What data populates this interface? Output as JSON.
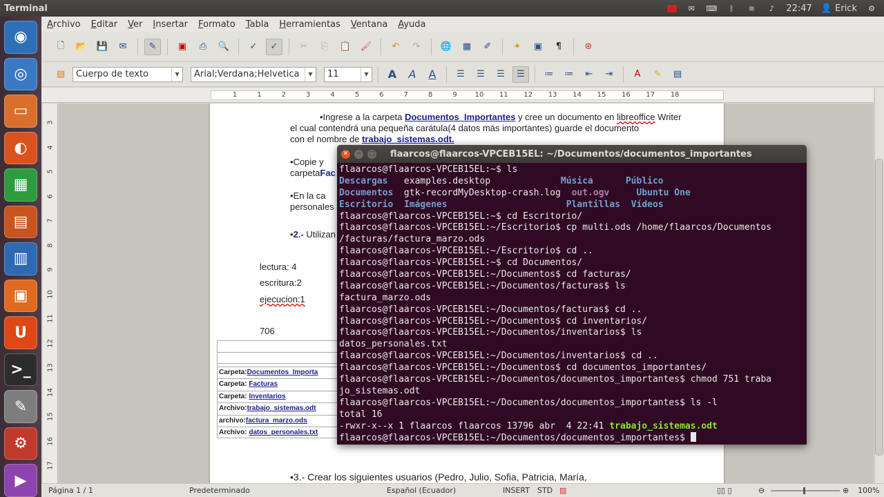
{
  "topbar": {
    "title": "Terminal",
    "time": "22:47",
    "user": "Erick"
  },
  "launcher": [
    {
      "name": "ubuntu-dash-icon",
      "glyph": "◉",
      "color": "#2e6fb7"
    },
    {
      "name": "chromium-icon",
      "glyph": "◎",
      "color": "#3b78c4"
    },
    {
      "name": "files-icon",
      "glyph": "▭",
      "color": "#d86f2a"
    },
    {
      "name": "firefox-icon",
      "glyph": "◐",
      "color": "#d9531e"
    },
    {
      "name": "calc-icon",
      "glyph": "▦",
      "color": "#2e9b3f"
    },
    {
      "name": "impress-icon",
      "glyph": "▤",
      "color": "#c8551f"
    },
    {
      "name": "writer-icon",
      "glyph": "▥",
      "color": "#2f68b3"
    },
    {
      "name": "software-center-icon",
      "glyph": "▣",
      "color": "#e06a1f"
    },
    {
      "name": "ubuntu-one-icon",
      "glyph": "U",
      "color": "#dd4814"
    },
    {
      "name": "terminal-icon",
      "glyph": ">_",
      "color": "#2c2c2c"
    },
    {
      "name": "text-editor-icon",
      "glyph": "✎",
      "color": "#7d7d7d"
    },
    {
      "name": "system-settings-icon",
      "glyph": "⚙",
      "color": "#c0392b"
    },
    {
      "name": "video-editor-icon",
      "glyph": "▶",
      "color": "#8e44ad"
    }
  ],
  "menu": [
    "Archivo",
    "Editar",
    "Ver",
    "Insertar",
    "Formato",
    "Tabla",
    "Herramientas",
    "Ventana",
    "Ayuda"
  ],
  "toolbar2": {
    "style": "Cuerpo de texto",
    "font": "Arial;Verdana;Helvetica",
    "size": "11"
  },
  "ruler_ticks": [
    "1",
    "1",
    "2",
    "3",
    "4",
    "5",
    "6",
    "7",
    "8",
    "9",
    "10",
    "11",
    "12",
    "13",
    "14",
    "15",
    "16",
    "17",
    "18"
  ],
  "vruler_ticks": [
    "3",
    "4",
    "5",
    "6",
    "7",
    "8",
    "9",
    "10",
    "11",
    "12",
    "13",
    "14",
    "15",
    "16",
    "17"
  ],
  "doc": {
    "p1": {
      "a": "•Ingrese a la carpeta ",
      "b": "Documentos_Importantes",
      "c": " y cree un documento en ",
      "d": "libreoffice",
      "e": " Writer"
    },
    "p1_l2": "el cual contendrá una pequeña carátula(4 datos más importantes) guarde el documento",
    "p1_l3a": "con el nombre de ",
    "p1_l3b": "trabajo_sistemas.odt.",
    "p2_a": "•Copie   y",
    "p2_b1": "carpeta",
    "p2_b2": "Fac",
    "p3_a": "•En   la   ca",
    "p3_b": "personales",
    "p4_a": "•",
    "p4_b": "2.-",
    "p4_c": " Utilizan",
    "perm1": "lectura: 4",
    "perm2": "escritura:2",
    "perm3": "ejecucion:1",
    "num": "706",
    "tbl": [
      {
        "k": "Carpeta:",
        "v": "Documentos_Importa"
      },
      {
        "k": "Carpeta: ",
        "v": "Facturas"
      },
      {
        "k": "Carpeta: ",
        "v": "Inventarios"
      },
      {
        "k": "Archivo:",
        "v": "trabajo_sistemas.odt"
      },
      {
        "k": "archivo:",
        "v": "factura_marzo.ods"
      },
      {
        "k": "Archivo: ",
        "v": "datos_personales.txt"
      }
    ],
    "p5": "•3.- Crear los  siguientes usuarios  (Pedro,  Julio,  Sofia,  Patricia,  María,"
  },
  "status": {
    "page": "Página 1 / 1",
    "style": "Predeterminado",
    "lang": "Español (Ecuador)",
    "mode": "INSERT",
    "sel": "STD",
    "zoom": "100%"
  },
  "terminal": {
    "title": "flaarcos@flaarcos-VPCEB15EL: ~/Documentos/documentos_importantes",
    "lines": [
      "flaarcos@flaarcos-VPCEB15EL:~$ ls",
      "",
      "",
      "",
      "flaarcos@flaarcos-VPCEB15EL:~$ cd Escritorio/",
      "flaarcos@flaarcos-VPCEB15EL:~/Escritorio$ cp multi.ods /home/flaarcos/Documentos",
      "/facturas/factura_marzo.ods",
      "flaarcos@flaarcos-VPCEB15EL:~/Escritorio$ cd ..",
      "flaarcos@flaarcos-VPCEB15EL:~$ cd Documentos/",
      "flaarcos@flaarcos-VPCEB15EL:~/Documentos$ cd facturas/",
      "flaarcos@flaarcos-VPCEB15EL:~/Documentos/facturas$ ls",
      "factura_marzo.ods",
      "flaarcos@flaarcos-VPCEB15EL:~/Documentos/facturas$ cd ..",
      "flaarcos@flaarcos-VPCEB15EL:~/Documentos$ cd inventarios/",
      "flaarcos@flaarcos-VPCEB15EL:~/Documentos/inventarios$ ls",
      "datos_personales.txt",
      "flaarcos@flaarcos-VPCEB15EL:~/Documentos/inventarios$ cd ..",
      "flaarcos@flaarcos-VPCEB15EL:~/Documentos$ cd documentos_importantes/",
      "flaarcos@flaarcos-VPCEB15EL:~/Documentos/documentos_importantes$ chmod 751 traba",
      "jo_sistemas.odt",
      "flaarcos@flaarcos-VPCEB15EL:~/Documentos/documentos_importantes$ ls -l",
      "total 16",
      "",
      "flaarcos@flaarcos-VPCEB15EL:~/Documentos/documentos_importantes$ "
    ],
    "ls_row1": [
      "Descargas",
      "   examples.desktop             ",
      "Música",
      "      ",
      "Público"
    ],
    "ls_row2": [
      "Documentos",
      "  gtk-recordMyDesktop-crash.log  ",
      "out.ogv",
      "     ",
      "Ubuntu One"
    ],
    "ls_row3": [
      "Escritorio",
      "  ",
      "Imágenes",
      "                      ",
      "Plantillas",
      "  ",
      "Vídeos"
    ],
    "ll_line": "-rwxr-x--x 1 flaarcos flaarcos 13796 abr  4 22:41 ",
    "ll_file": "trabajo_sistemas.odt"
  }
}
